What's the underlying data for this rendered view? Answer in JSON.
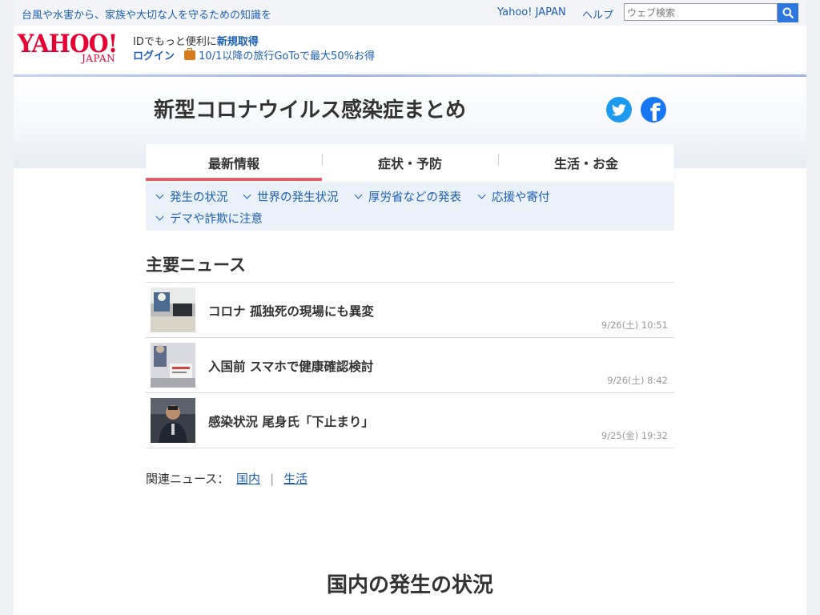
{
  "topbar": {
    "notice": "台風や水害から、家族や大切な人を守るための知識を",
    "yahoo_japan_link": "Yahoo! JAPAN",
    "help_link": "ヘルプ",
    "search_placeholder": "ウェブ検索"
  },
  "header": {
    "logo_text": "YAHOO!",
    "logo_sub": "JAPAN",
    "id_text": "IDでもっと便利に",
    "register_link": "新規取得",
    "login_link": "ログイン",
    "goto_link": "10/1以降の旅行GoToで最大50%お得"
  },
  "page": {
    "title": "新型コロナウイルス感染症まとめ"
  },
  "social": {
    "twitter": "twitter-icon",
    "facebook": "facebook-icon",
    "facebook_glyph": "f"
  },
  "tabs": [
    {
      "label": "最新情報",
      "active": true
    },
    {
      "label": "症状・予防",
      "active": false
    },
    {
      "label": "生活・お金",
      "active": false
    }
  ],
  "sublinks": [
    {
      "label": "発生の状況"
    },
    {
      "label": "世界の発生状況"
    },
    {
      "label": "厚労省などの発表"
    },
    {
      "label": "応援や寄付"
    },
    {
      "label": "デマや詐欺に注意"
    }
  ],
  "news": {
    "title": "主要ニュース",
    "items": [
      {
        "title": "コロナ 孤独死の現場にも異変",
        "time": "9/26(土) 10:51"
      },
      {
        "title": "入国前 スマホで健康確認検討",
        "time": "9/26(土) 8:42"
      },
      {
        "title": "感染状況 尾身氏「下止まり」",
        "time": "9/25(金) 19:32"
      }
    ]
  },
  "related": {
    "label": "関連ニュース：",
    "links": [
      "国内",
      "生活"
    ],
    "separator": "|"
  },
  "next_section": {
    "title": "国内の発生の状況"
  },
  "colors": {
    "link": "#1d5fb8",
    "tab_accent": "#e35f68",
    "brand_red": "#e60033",
    "search_button": "#2c77de"
  }
}
